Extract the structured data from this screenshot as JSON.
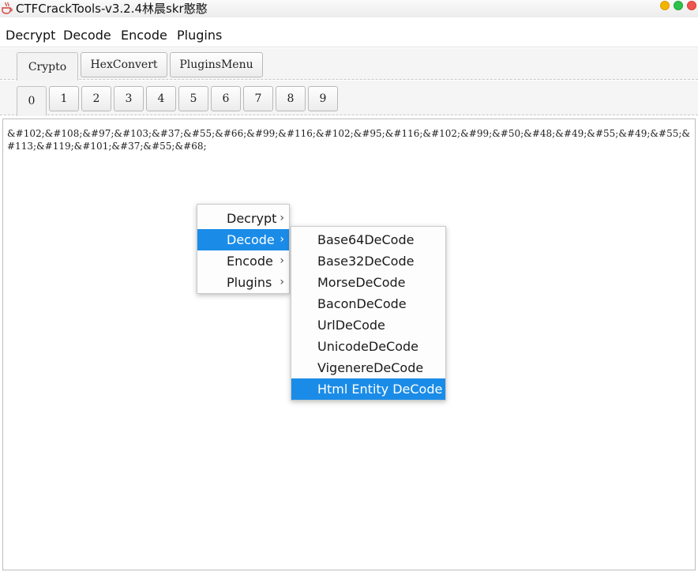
{
  "window": {
    "title": "CTFCrackTools-v3.2.4林晨skr憨憨"
  },
  "menubar": {
    "items": [
      "Decrypt",
      "Decode",
      "Encode",
      "Plugins"
    ]
  },
  "top_tabs": {
    "items": [
      "Crypto",
      "HexConvert",
      "PluginsMenu"
    ],
    "selected": "Crypto"
  },
  "sub_tabs": {
    "items": [
      "0",
      "1",
      "2",
      "3",
      "4",
      "5",
      "6",
      "7",
      "8",
      "9"
    ],
    "selected": "0"
  },
  "editor": {
    "text": "&#102;&#108;&#97;&#103;&#37;&#55;&#66;&#99;&#116;&#102;&#95;&#116;&#102;&#99;&#50;&#48;&#49;&#55;&#49;&#55;&#113;&#119;&#101;&#37;&#55;&#68;"
  },
  "context_menu": {
    "items": [
      "Decrypt",
      "Decode",
      "Encode",
      "Plugins"
    ],
    "active": "Decode",
    "chevron": "›"
  },
  "decode_submenu": {
    "items": [
      "Base64DeCode",
      "Base32DeCode",
      "MorseDeCode",
      "BaconDeCode",
      "UrlDeCode",
      "UnicodeDeCode",
      "VigenereDeCode",
      "Html Entity DeCode"
    ],
    "active": "Html Entity DeCode"
  },
  "colors": {
    "highlight": "#1a8ce8",
    "window_min": "#f4b400",
    "window_max": "#2fc24a",
    "window_close": "#f0544f"
  },
  "icons": {
    "app": "coffee-cup-icon",
    "submenu": "chevron-right-icon"
  }
}
